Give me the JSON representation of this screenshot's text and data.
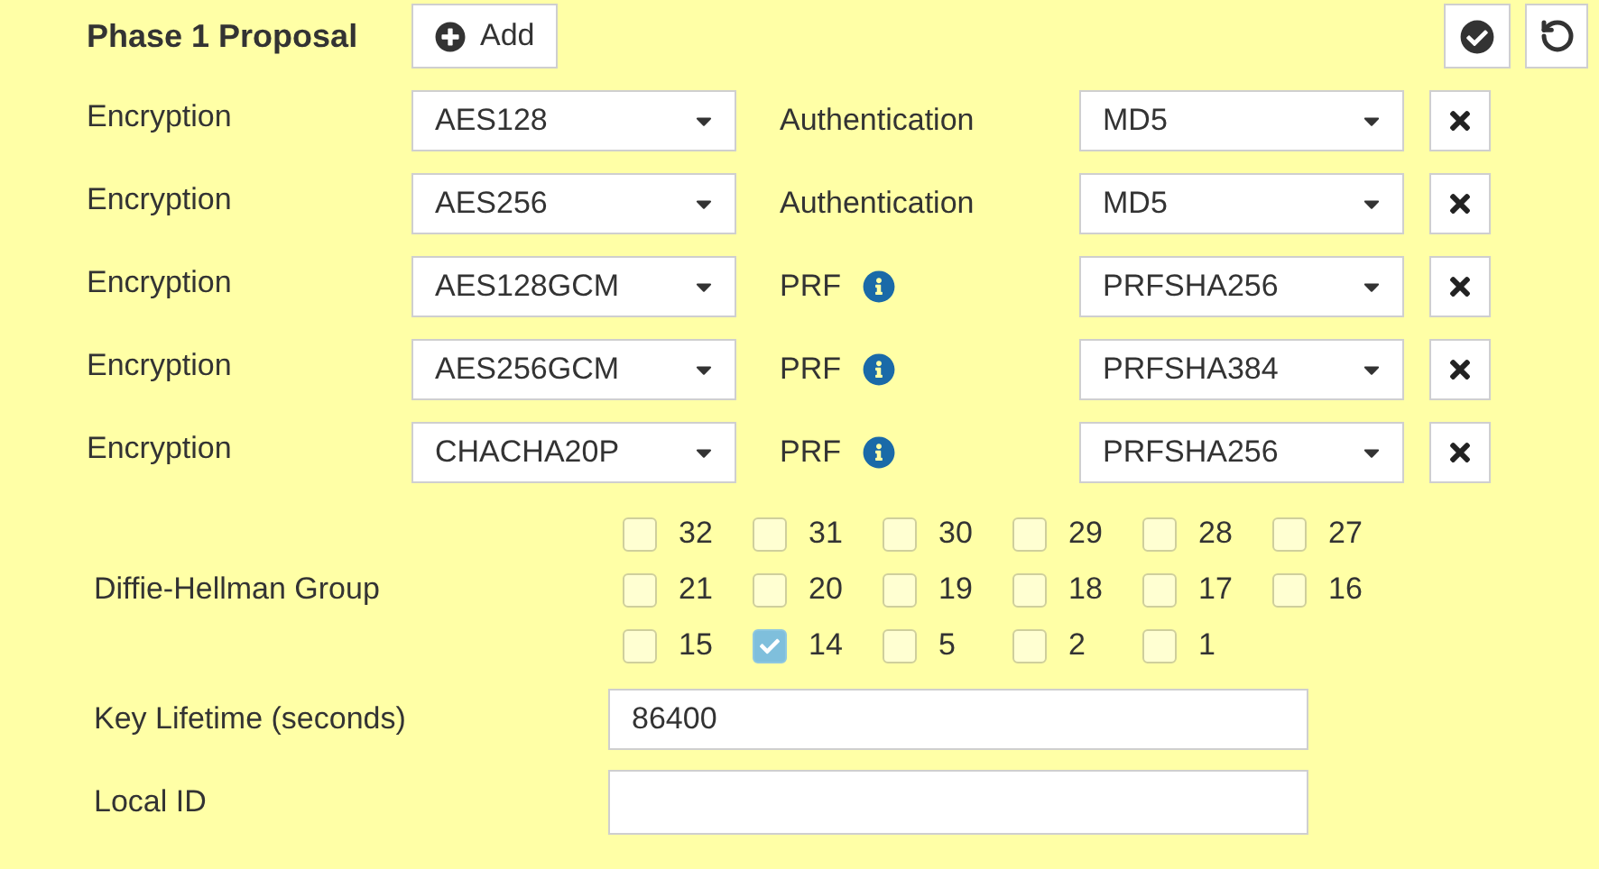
{
  "header": {
    "title": "Phase 1 Proposal",
    "add_button": "Add"
  },
  "proposals": [
    {
      "label": "Encryption",
      "encryption": "AES128",
      "kind": "authentication",
      "second_label": "Authentication",
      "second_value": "MD5"
    },
    {
      "label": "Encryption",
      "encryption": "AES256",
      "kind": "authentication",
      "second_label": "Authentication",
      "second_value": "MD5"
    },
    {
      "label": "Encryption",
      "encryption": "AES128GCM",
      "kind": "prf",
      "second_label": "PRF",
      "second_value": "PRFSHA256"
    },
    {
      "label": "Encryption",
      "encryption": "AES256GCM",
      "kind": "prf",
      "second_label": "PRF",
      "second_value": "PRFSHA384"
    },
    {
      "label": "Encryption",
      "encryption": "CHACHA20P",
      "kind": "prf",
      "second_label": "PRF",
      "second_value": "PRFSHA256"
    }
  ],
  "dh_group": {
    "label": "Diffie-Hellman Group",
    "options": [
      {
        "label": "32",
        "checked": false
      },
      {
        "label": "31",
        "checked": false
      },
      {
        "label": "30",
        "checked": false
      },
      {
        "label": "29",
        "checked": false
      },
      {
        "label": "28",
        "checked": false
      },
      {
        "label": "27",
        "checked": false
      },
      {
        "label": "21",
        "checked": false
      },
      {
        "label": "20",
        "checked": false
      },
      {
        "label": "19",
        "checked": false
      },
      {
        "label": "18",
        "checked": false
      },
      {
        "label": "17",
        "checked": false
      },
      {
        "label": "16",
        "checked": false
      },
      {
        "label": "15",
        "checked": false
      },
      {
        "label": "14",
        "checked": true
      },
      {
        "label": "5",
        "checked": false
      },
      {
        "label": "2",
        "checked": false
      },
      {
        "label": "1",
        "checked": false
      }
    ]
  },
  "key_lifetime": {
    "label": "Key Lifetime (seconds)",
    "value": "86400"
  },
  "local_id": {
    "label": "Local ID"
  }
}
